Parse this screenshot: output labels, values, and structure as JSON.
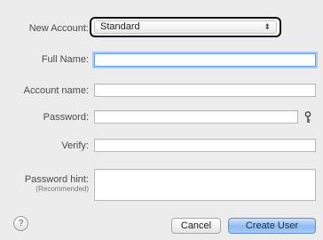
{
  "form": {
    "new_account": {
      "label": "New Account:",
      "value": "Standard",
      "arrows": "⬍"
    },
    "full_name": {
      "label": "Full Name:",
      "value": ""
    },
    "account_name": {
      "label": "Account name:",
      "value": ""
    },
    "password": {
      "label": "Password:",
      "value": ""
    },
    "verify": {
      "label": "Verify:",
      "value": ""
    },
    "password_hint": {
      "label": "Password hint:",
      "sublabel": "(Recommended)",
      "value": ""
    }
  },
  "footer": {
    "help": "?",
    "cancel": "Cancel",
    "create": "Create User"
  },
  "icons": {
    "help": "question-mark-icon",
    "password_assistant": "key-icon",
    "popup_arrows": "up-down-arrows-icon"
  }
}
